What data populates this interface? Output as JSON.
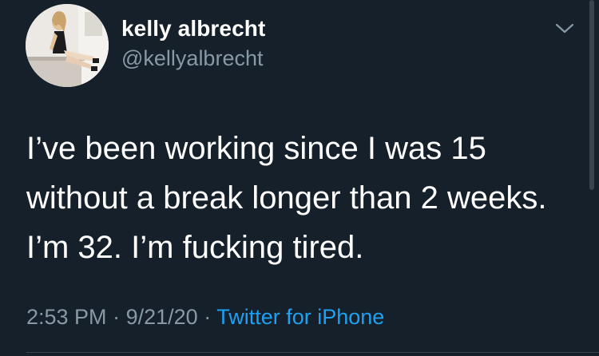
{
  "user": {
    "display_name": "kelly albrecht",
    "handle": "@kellyalbrecht"
  },
  "tweet": {
    "lines": [
      "I’ve been working since I was 15",
      "without a break longer than 2 weeks.",
      "I’m 32. I’m fucking tired."
    ],
    "time": "2:53 PM",
    "separator": "·",
    "date": "9/21/20",
    "source": "Twitter for iPhone"
  },
  "icons": {
    "avatar": "profile-photo",
    "menu": "chevron-down-icon"
  },
  "colors": {
    "background": "#15202b",
    "text": "#ffffff",
    "secondary_text": "#8899a6",
    "link": "#1da1f2"
  }
}
